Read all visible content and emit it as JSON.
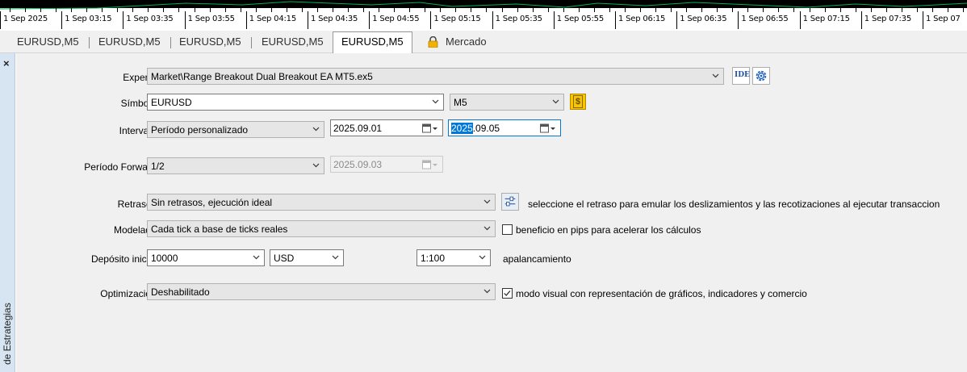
{
  "time_axis": {
    "labels": [
      "1 Sep 2025",
      "1 Sep 03:15",
      "1 Sep 03:35",
      "1 Sep 03:55",
      "1 Sep 04:15",
      "1 Sep 04:35",
      "1 Sep 04:55",
      "1 Sep 05:15",
      "1 Sep 05:35",
      "1 Sep 05:55",
      "1 Sep 06:15",
      "1 Sep 06:35",
      "1 Sep 06:55",
      "1 Sep 07:15",
      "1 Sep 07:35",
      "1 Sep 07"
    ]
  },
  "chart_tabs": [
    "EURUSD,M5",
    "EURUSD,M5",
    "EURUSD,M5",
    "EURUSD,M5",
    "EURUSD,M5"
  ],
  "market_tab": "Mercado",
  "side_panel": {
    "close": "×",
    "title": "de Estrategias"
  },
  "form": {
    "expert": {
      "label": "Experto:",
      "value": "Market\\Range Breakout Dual Breakout EA MT5.ex5",
      "ide_label": "IDE"
    },
    "symbol": {
      "label": "Símbolo:",
      "value": "EURUSD",
      "timeframe": "M5",
      "dollar_symbol": "$"
    },
    "interval": {
      "label": "Intervalo:",
      "value": "Período personalizado",
      "from": "2025.09.01",
      "to_selected": "2025",
      "to_rest": ".09.05"
    },
    "forward": {
      "label": "Período Forward:",
      "value": "1/2",
      "date": "2025.09.03"
    },
    "delays": {
      "label": "Retrasos:",
      "value": "Sin retrasos, ejecución ideal",
      "hint": "seleccione el retraso para emular los deslizamientos y las recotizaciones al ejecutar transaccion"
    },
    "modeling": {
      "label": "Modelado:",
      "value": "Cada tick a base de ticks reales",
      "pips_checkbox_label": "beneficio en pips para acelerar los cálculos",
      "pips_checked": false
    },
    "deposit": {
      "label": "Depósito inicial:",
      "value": "10000",
      "currency": "USD",
      "leverage": "1:100",
      "leverage_label": "apalancamiento"
    },
    "optimization": {
      "label": "Optimización:",
      "value": "Deshabilitado",
      "visual_checkbox_label": "modo visual con representación de gráficos, indicadores y comercio",
      "visual_checked": true
    }
  },
  "colors": {
    "accent": "#0078d7",
    "side_strip": "#d7e5f3",
    "lock": "#f2b300"
  }
}
